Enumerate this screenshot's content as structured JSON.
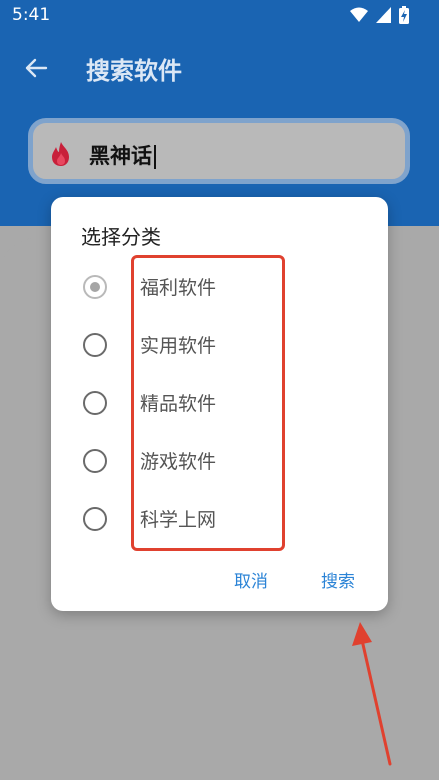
{
  "status_bar": {
    "time": "5:41"
  },
  "toolbar": {
    "title": "搜索软件"
  },
  "search": {
    "value": "黑神话"
  },
  "dialog": {
    "title": "选择分类",
    "options": [
      {
        "label": "福利软件",
        "checked": true
      },
      {
        "label": "实用软件",
        "checked": false
      },
      {
        "label": "精品软件",
        "checked": false
      },
      {
        "label": "游戏软件",
        "checked": false
      },
      {
        "label": "科学上网",
        "checked": false
      }
    ],
    "cancel_label": "取消",
    "confirm_label": "搜索"
  },
  "colors": {
    "header_blue": "#1a64b2",
    "accent_blue": "#2a83d6",
    "annotation_red": "#e0412f",
    "flame_red": "#c8203a"
  },
  "icons": {
    "back": "back-arrow-icon",
    "search_prefix": "flame-icon",
    "wifi": "wifi-icon",
    "signal": "signal-icon",
    "battery": "battery-icon"
  }
}
